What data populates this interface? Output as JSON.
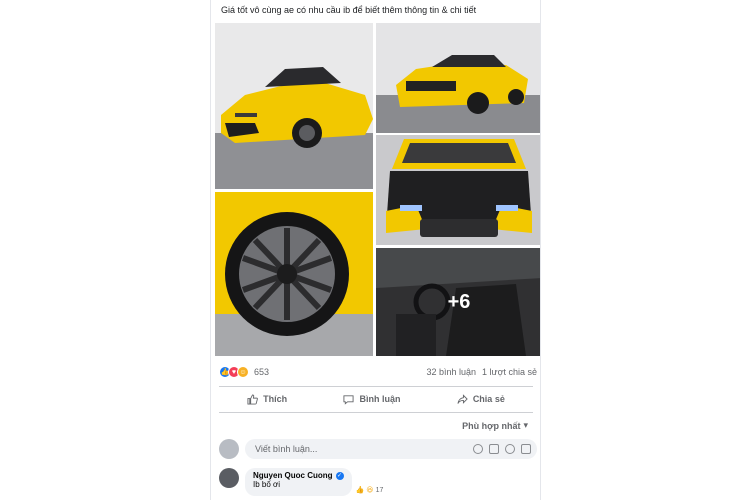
{
  "post": {
    "caption": "Giá tốt vô cùng ae có nhu cầu ib để biết thêm thông tin & chi tiết",
    "more_photos": "+6"
  },
  "reactions": {
    "count": "653",
    "comments": "32 bình luận",
    "shares": "1 lượt chia sẻ",
    "icons": [
      "like-icon",
      "love-icon",
      "care-icon"
    ],
    "colors": {
      "like": "#1877f2",
      "love": "#f33e58",
      "care": "#f7b125"
    }
  },
  "actions": {
    "like": "Thích",
    "comment": "Bình luận",
    "share": "Chia sẻ"
  },
  "comments": {
    "sort_label": "Phù hợp nhất",
    "placeholder": "Viết bình luận...",
    "items": [
      {
        "name": "Nguyen Quoc Cuong",
        "text": "Ib bố ơi",
        "reaction_count": "17"
      }
    ]
  },
  "theme": {
    "car_color": "#f2c800",
    "accent": "#1877f2"
  }
}
